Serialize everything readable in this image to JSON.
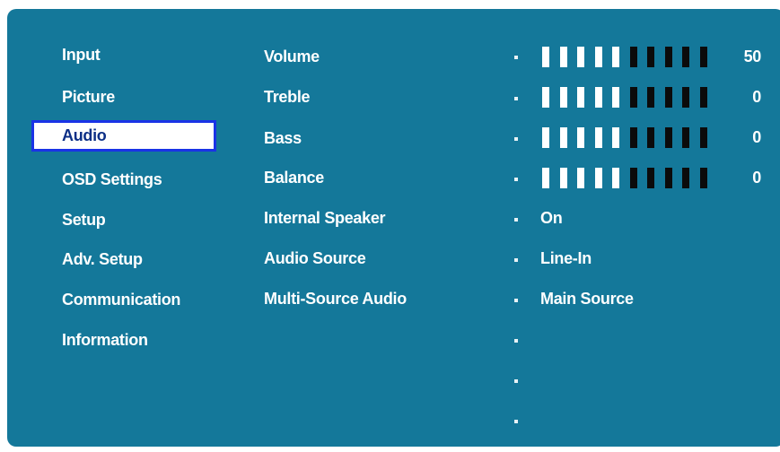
{
  "menu": {
    "items": [
      {
        "label": "Input"
      },
      {
        "label": "Picture"
      },
      {
        "label": "Audio",
        "selected": true
      },
      {
        "label": "OSD Settings"
      },
      {
        "label": "Setup"
      },
      {
        "label": "Adv. Setup"
      },
      {
        "label": "Communication"
      },
      {
        "label": "Information"
      }
    ]
  },
  "audio": {
    "settings": [
      {
        "label": "Volume",
        "type": "slider",
        "value": "50",
        "level": 0.5
      },
      {
        "label": "Treble",
        "type": "slider",
        "value": "0",
        "level": 0.5
      },
      {
        "label": "Bass",
        "type": "slider",
        "value": "0",
        "level": 0.5
      },
      {
        "label": "Balance",
        "type": "slider",
        "value": "0",
        "level": 0.5
      },
      {
        "label": "Internal Speaker",
        "type": "text",
        "value": "On"
      },
      {
        "label": "Audio Source",
        "type": "text",
        "value": "Line-In"
      },
      {
        "label": "Multi-Source Audio",
        "type": "text",
        "value": "Main Source"
      }
    ],
    "slider_segments": 10
  },
  "colors": {
    "background": "#14789a",
    "selection_border": "#1a33e6",
    "selected_text": "#0c2f86",
    "bar_on": "#ffffff",
    "bar_off": "#0b0b0b"
  }
}
